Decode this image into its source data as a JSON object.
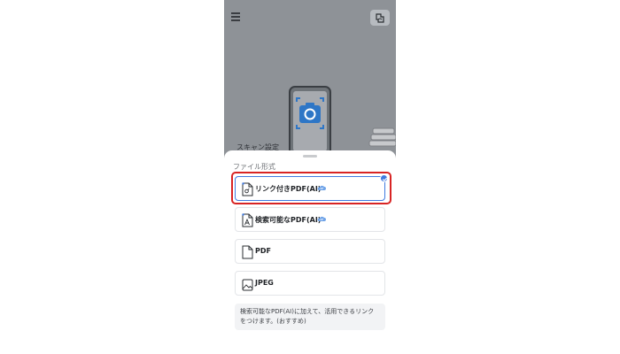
{
  "top_bar": {
    "menu_icon": "hamburger-menu-icon",
    "right_button_icon": "scan-mode-icon"
  },
  "background": {
    "peek_label": "スキャン設定"
  },
  "sheet": {
    "title": "ファイル形式",
    "options": [
      {
        "label": "リンク付きPDF(AI)",
        "icon": "pdf-with-link-icon",
        "ai_badge": true,
        "selected": true
      },
      {
        "label": "検索可能なPDF(AI)",
        "icon": "searchable-pdf-icon",
        "ai_badge": true,
        "selected": false
      },
      {
        "label": "PDF",
        "icon": "pdf-file-icon",
        "ai_badge": false,
        "selected": false
      },
      {
        "label": "JPEG",
        "icon": "image-file-icon",
        "ai_badge": false,
        "selected": false
      }
    ],
    "description": "検索可能なPDF(AI)に加えて、活用できるリンクをつけます。(おすすめ)"
  },
  "colors": {
    "accent": "#3f7ae0",
    "highlight": "#d82424",
    "camera_blue": "#2e76c6",
    "overlay": "#8e9297"
  }
}
